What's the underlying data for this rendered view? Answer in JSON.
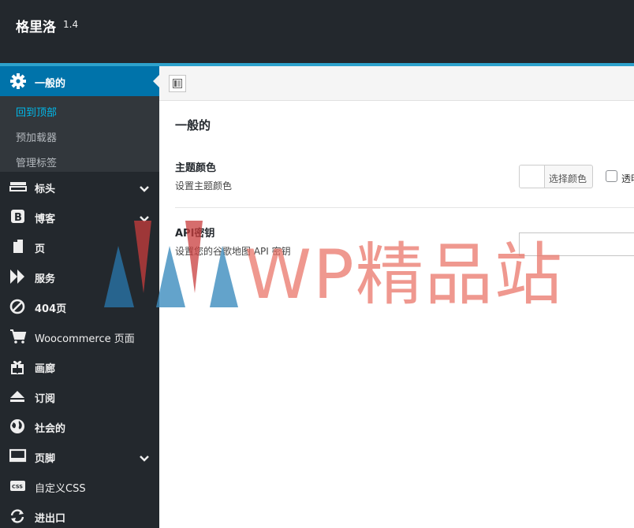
{
  "header": {
    "title": "格里洛",
    "version": "1.4"
  },
  "sidebar": {
    "active": {
      "label": "一般的",
      "icon": "gear-icon"
    },
    "submenu": [
      {
        "label": "回到顶部",
        "current": true
      },
      {
        "label": "预加载器"
      },
      {
        "label": "管理标签"
      }
    ],
    "items": [
      {
        "label": "标头",
        "icon": "header-icon",
        "has_children": true
      },
      {
        "label": "博客",
        "icon": "blog-icon",
        "has_children": true
      },
      {
        "label": "页",
        "icon": "page-icon",
        "has_children": false
      },
      {
        "label": "服务",
        "icon": "services-icon",
        "has_children": false
      },
      {
        "label": "404页",
        "icon": "forbidden-icon",
        "has_children": false
      },
      {
        "label": "Woocommerce 页面",
        "icon": "cart-icon",
        "has_children": false
      },
      {
        "label": "画廊",
        "icon": "gift-icon",
        "has_children": false
      },
      {
        "label": "订阅",
        "icon": "eject-icon",
        "has_children": false
      },
      {
        "label": "社会的",
        "icon": "globe-icon",
        "has_children": false
      },
      {
        "label": "页脚",
        "icon": "footer-icon",
        "has_children": true
      },
      {
        "label": "自定义CSS",
        "icon": "css-icon",
        "has_children": false
      },
      {
        "label": "进出口",
        "icon": "import-export-icon",
        "has_children": false
      }
    ]
  },
  "main": {
    "section_title": "一般的",
    "fields": [
      {
        "label": "主题颜色",
        "description": "设置主题颜色",
        "button_label": "选择颜色",
        "checkbox_label": "透明"
      },
      {
        "label": "API密钥",
        "description": "设置您的谷歌地图 API 密钥",
        "value": ""
      }
    ]
  },
  "watermark": {
    "text": "WP精品站"
  },
  "colors": {
    "topbar": "#23282d",
    "accent": "#2ea2cc",
    "active_item": "#0073aa",
    "submenu_bg": "#32373c",
    "watermark": "#e97064"
  }
}
